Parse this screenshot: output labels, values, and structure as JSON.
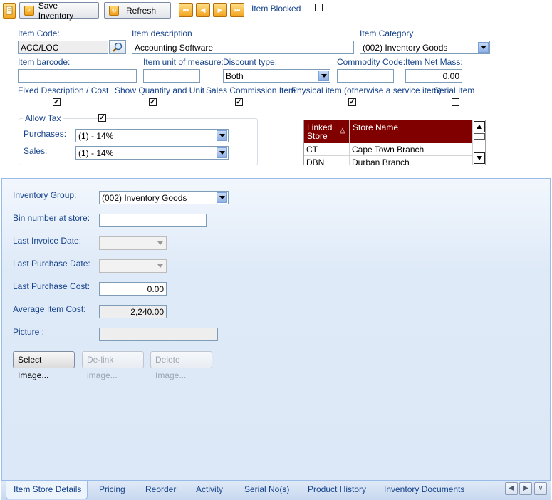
{
  "toolbar": {
    "save_label": "Save Inventory",
    "refresh_label": "Refresh",
    "item_blocked_label": "Item Blocked",
    "item_blocked_checked": false
  },
  "form": {
    "item_code": {
      "label": "Item Code:",
      "value": "ACC/LOC"
    },
    "item_description": {
      "label": "Item description",
      "value": "Accounting Software"
    },
    "item_category": {
      "label": "Item Category",
      "value": "(002) Inventory Goods"
    },
    "item_barcode": {
      "label": "Item barcode:",
      "value": ""
    },
    "unit_of_measure": {
      "label": "Item unit of measure:",
      "value": ""
    },
    "discount_type": {
      "label": "Discount type:",
      "value": "Both"
    },
    "commodity_code": {
      "label": "Commodity Code:",
      "value": ""
    },
    "net_mass": {
      "label": "Item Net Mass:",
      "value": "0.00"
    }
  },
  "flags": [
    {
      "label": "Fixed Description / Cost",
      "checked": true
    },
    {
      "label": "Show Quantity and Unit",
      "checked": true
    },
    {
      "label": "Sales Commission Item",
      "checked": true
    },
    {
      "label": "Physical item (otherwise a service item)",
      "checked": true
    },
    {
      "label": "Serial Item",
      "checked": false
    }
  ],
  "tax": {
    "allow_tax_label": "Allow Tax",
    "allow_tax_checked": true,
    "purchases_label": "Purchases:",
    "purchases_value": "(1) - 14%",
    "sales_label": "Sales:",
    "sales_value": "(1) - 14%"
  },
  "stores": {
    "columns": [
      "Linked Store",
      "Store Name"
    ],
    "sort_indicator": "△",
    "rows": [
      {
        "code": "CT",
        "name": "Cape Town Branch"
      },
      {
        "code": "DBN",
        "name": "Durban Branch"
      }
    ]
  },
  "details": {
    "inventory_group": {
      "label": "Inventory Group:",
      "value": "(002) Inventory Goods"
    },
    "bin_number": {
      "label": "Bin number at store:",
      "value": ""
    },
    "last_invoice_date": {
      "label": "Last Invoice Date:",
      "value": ""
    },
    "last_purchase_date": {
      "label": "Last Purchase Date:",
      "value": ""
    },
    "last_purchase_cost": {
      "label": "Last Purchase Cost:",
      "value": "0.00"
    },
    "average_item_cost": {
      "label": "Average Item Cost:",
      "value": "2,240.00"
    },
    "picture": {
      "label": "Picture :",
      "value": ""
    },
    "select_image": "Select Image...",
    "delink_image": "De-link image...",
    "delete_image": "Delete Image..."
  },
  "tabs": [
    "Item Store Details",
    "Pricing",
    "Reorder",
    "Activity",
    "Serial No(s)",
    "Product History",
    "Inventory Documents"
  ],
  "active_tab": 0,
  "colors": {
    "label_blue": "#15428b",
    "grid_header": "#800000",
    "panel_border": "#99bbe8"
  }
}
